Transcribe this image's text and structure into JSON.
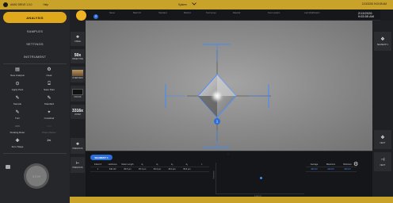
{
  "titlebar": {
    "app_name": "AMH2 DRIVE 1.0.0",
    "help": "Help",
    "center_label": "System",
    "center_chevron": "chevron-down-icon",
    "right_text": "2/13/2026 9:03:55 AM"
  },
  "sidebar": {
    "nav": [
      {
        "label": "ANALYSIS",
        "active": true
      },
      {
        "label": "SAMPLES",
        "active": false
      },
      {
        "label": "SETTINGS",
        "active": false
      },
      {
        "label": "INSTRUMENT",
        "active": false
      }
    ],
    "tools": [
      {
        "label": "New Analysis",
        "icon": "new-analysis-icon",
        "enabled": true
      },
      {
        "label": "Clear",
        "icon": "clear-icon",
        "enabled": true
      },
      {
        "label": "Apply Pars",
        "icon": "apply-pars-icon",
        "enabled": true
      },
      {
        "label": "Save Pars",
        "icon": "save-pars-icon",
        "enabled": true
      },
      {
        "label": "Sample",
        "icon": "sample-icon",
        "enabled": true
      },
      {
        "label": "Standard",
        "icon": "standard-icon",
        "enabled": true
      },
      {
        "label": "Turn",
        "icon": "turn-icon",
        "enabled": true
      },
      {
        "label": "Crosshair",
        "icon": "crosshair-icon",
        "enabled": true
      },
      {
        "label": "Floating Ruler",
        "icon": "floating-ruler-icon",
        "enabled": true
      },
      {
        "label": "Place Marker",
        "icon": "place-marker-icon",
        "enabled": false
      },
      {
        "label": "Zero Stage",
        "icon": "zero-stage-icon",
        "enabled": true
      },
      {
        "label": "",
        "icon": "scissors-icon",
        "enabled": true
      }
    ],
    "stop_label": "STOP"
  },
  "tools_col": {
    "items": [
      {
        "label": "TABLE",
        "icon": "table-icon"
      },
      {
        "label": "OBJECTIVE",
        "value": "50x"
      },
      {
        "label": "OVERVIEW",
        "icon": "overview-thumb"
      },
      {
        "label": "FOCUS",
        "icon": "focus-thumb"
      },
      {
        "label": "ZOOM",
        "value": "3316x"
      },
      {
        "label": "PREVIOUS",
        "icon": "move-icon"
      },
      {
        "label": "PREVIOUS",
        "icon": "prev-icon"
      }
    ]
  },
  "infobar": {
    "columns": [
      "Name",
      "Batch ID",
      "Standard",
      "Method",
      "Test Group",
      "Material",
      "Test Location",
      "Last Modification"
    ],
    "date_line1": "2/13/2026",
    "date_line2": "9:03:55 AM",
    "help_icon": "question-icon"
  },
  "rightcol": {
    "items": [
      {
        "label": "SEGMENT 1",
        "icon": "move-icon"
      },
      {
        "label": "NEXT",
        "icon": "move-icon"
      },
      {
        "label": "NEXT",
        "icon": "next-icon"
      }
    ]
  },
  "viewport": {
    "marker_label": "1"
  },
  "bottom": {
    "tab_label": "SEGMENT 1",
    "table": {
      "headers": [
        "Indent #",
        "Hardness",
        "Mean Length",
        "d₁",
        "d₂",
        "d₃",
        "d₄",
        "z"
      ],
      "rows": [
        [
          "1",
          "440 HV",
          "39.5 µm",
          "39.7 µm",
          "39.3 µm",
          "39.4 µm",
          "39.6 µm",
          ""
        ]
      ]
    },
    "chart": {
      "ylabel": "Hardness",
      "xlabel": "Indent #"
    },
    "stats": {
      "headers": [
        "Average",
        "Maximum",
        "Minimum"
      ],
      "values": [
        "440 HV",
        "440 HV",
        "440 HV"
      ]
    }
  },
  "chart_data": {
    "type": "scatter",
    "title": "",
    "xlabel": "Indent #",
    "ylabel": "Hardness",
    "series": [
      {
        "values": [
          {
            "x": 1,
            "y": 440
          }
        ]
      }
    ]
  },
  "colors": {
    "accent": "#e0a91c",
    "brand_bar": "#c9a22a",
    "primary_blue": "#2b6fd8",
    "measure_blue": "#3d8cff"
  }
}
